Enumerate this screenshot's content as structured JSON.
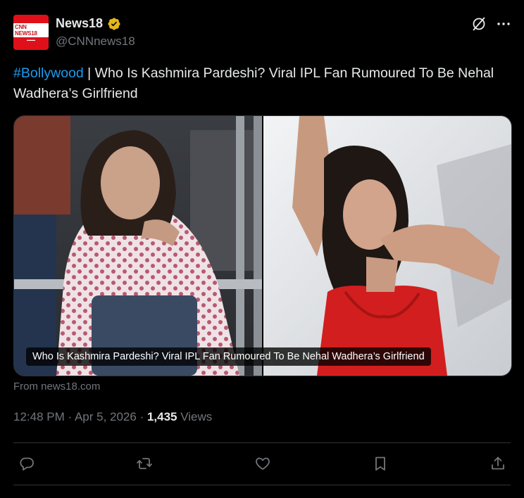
{
  "author": {
    "display_name": "News18",
    "handle": "@CNNnews18",
    "avatar_logo": "CNN NEWS18",
    "verified": true,
    "badge_color": "#e2b719"
  },
  "tweet": {
    "hashtag": "#Bollywood",
    "text": " | Who Is Kashmira Pardeshi? Viral IPL Fan Rumoured To Be Nehal Wadhera’s Girlfriend"
  },
  "card": {
    "caption": "Who Is Kashmira Pardeshi? Viral IPL Fan Rumoured To Be Nehal Wadhera’s Girlfriend",
    "source": "From news18.com"
  },
  "meta": {
    "time": "12:48 PM",
    "separator": " · ",
    "date": "Apr 5, 2026",
    "views_count": "1,435",
    "views_label": " Views"
  },
  "icons": {
    "header": [
      "grok-icon",
      "more-icon"
    ],
    "actions": [
      "reply-icon",
      "retweet-icon",
      "like-icon",
      "bookmark-icon",
      "share-icon"
    ]
  },
  "colors": {
    "background": "#000000",
    "text": "#e7e9ea",
    "secondary": "#71767b",
    "link": "#1d9bf0",
    "divider": "#2f3336"
  }
}
